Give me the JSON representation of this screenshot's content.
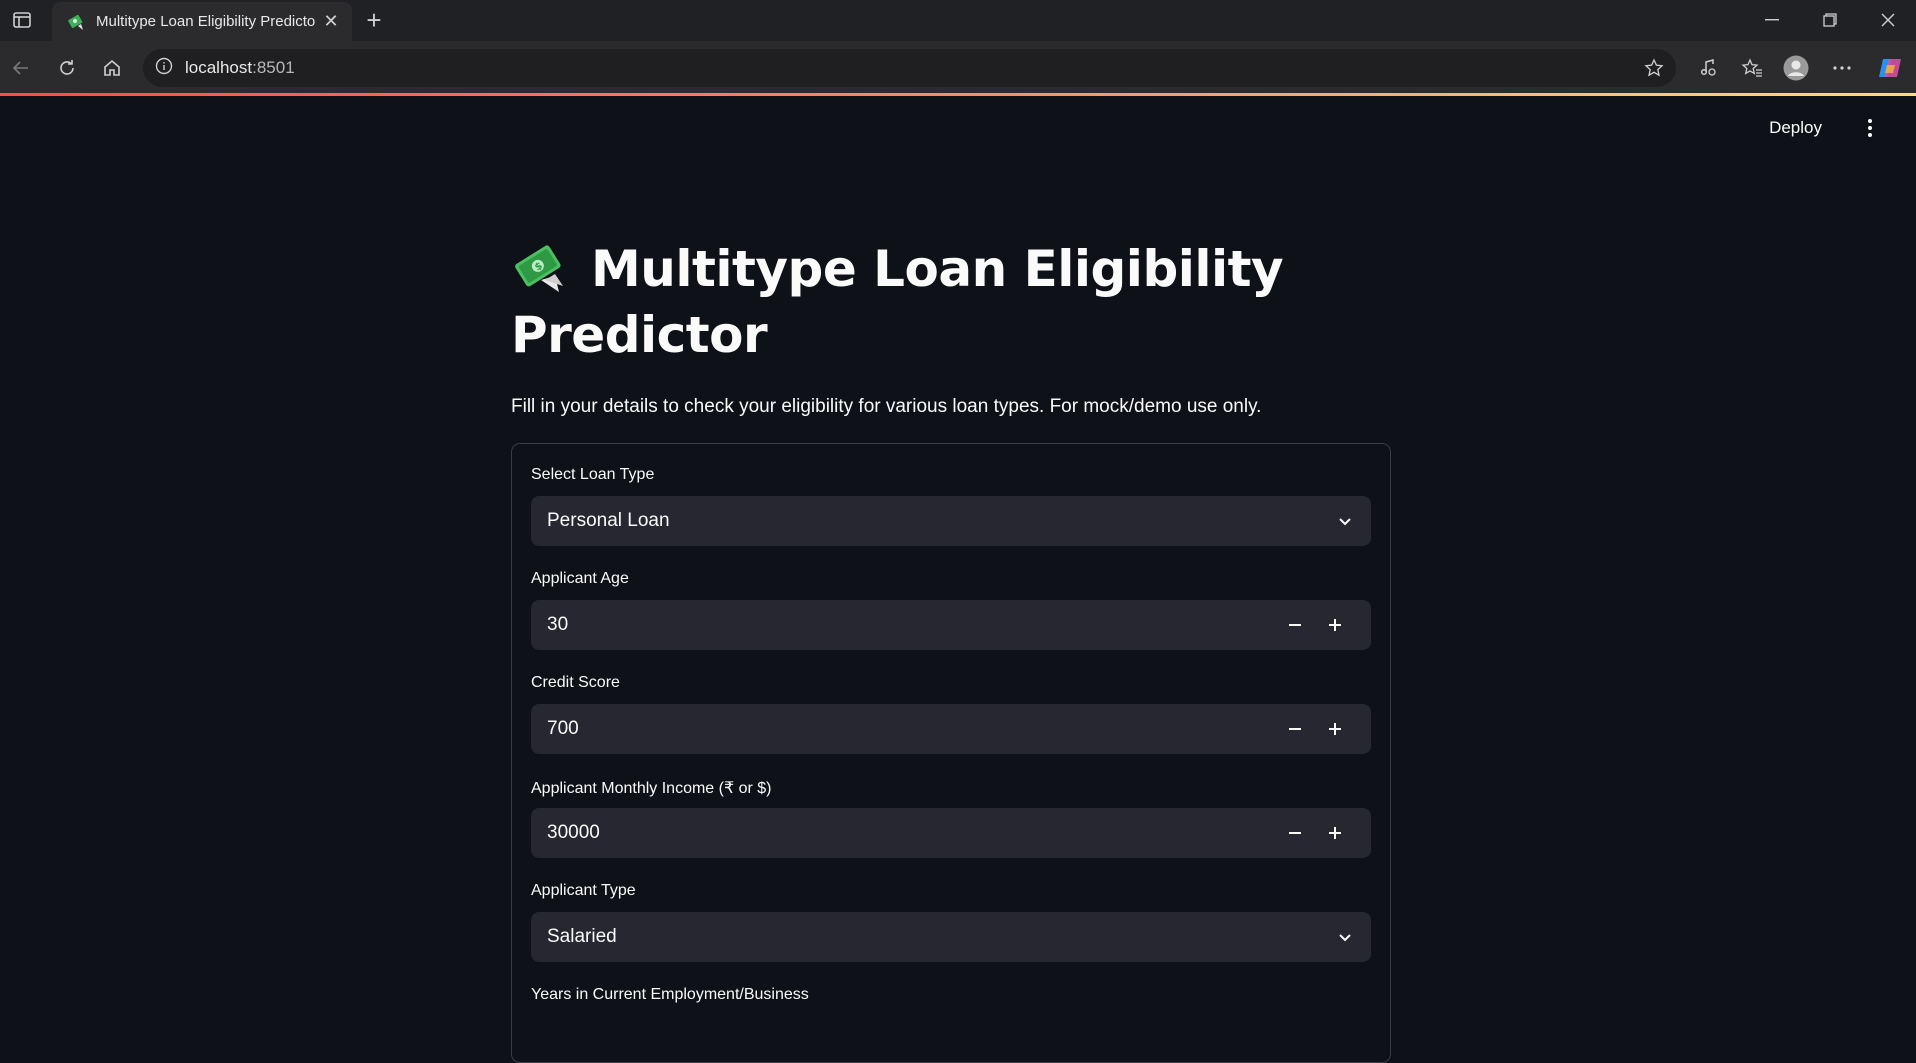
{
  "browser": {
    "tab_title": "Multitype Loan Eligibility Predicto",
    "url_host": "localhost",
    "url_port": ":8501"
  },
  "app": {
    "deploy_label": "Deploy",
    "title_line1": "Multitype Loan Eligibility",
    "title_line2": "Predictor",
    "subtitle": "Fill in your details to check your eligibility for various loan types. For mock/demo use only.",
    "form": {
      "loan_type": {
        "label": "Select Loan Type",
        "value": "Personal Loan"
      },
      "age": {
        "label": "Applicant Age",
        "value": "30"
      },
      "credit_score": {
        "label": "Credit Score",
        "value": "700"
      },
      "monthly_income": {
        "label": "Applicant Monthly Income (₹ or $)",
        "value": "30000"
      },
      "applicant_type": {
        "label": "Applicant Type",
        "value": "Salaried"
      },
      "years_employment": {
        "label": "Years in Current Employment/Business"
      }
    }
  }
}
